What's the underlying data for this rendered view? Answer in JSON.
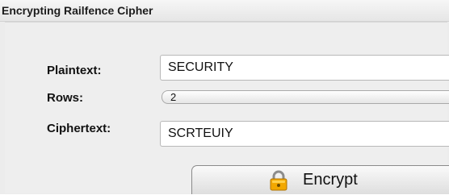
{
  "window": {
    "title": "Encrypting Railfence Cipher"
  },
  "form": {
    "plaintext_label": "Plaintext:",
    "plaintext_value": "SECURITY",
    "rows_label": "Rows:",
    "rows_value": "2",
    "ciphertext_label": "Ciphertext:",
    "ciphertext_value": "SCRTEUIY"
  },
  "actions": {
    "encrypt_label": "Encrypt",
    "encrypt_icon": "lock-icon"
  },
  "colors": {
    "lock_body": "#f2a800",
    "lock_shackle": "#8c8c8c"
  }
}
